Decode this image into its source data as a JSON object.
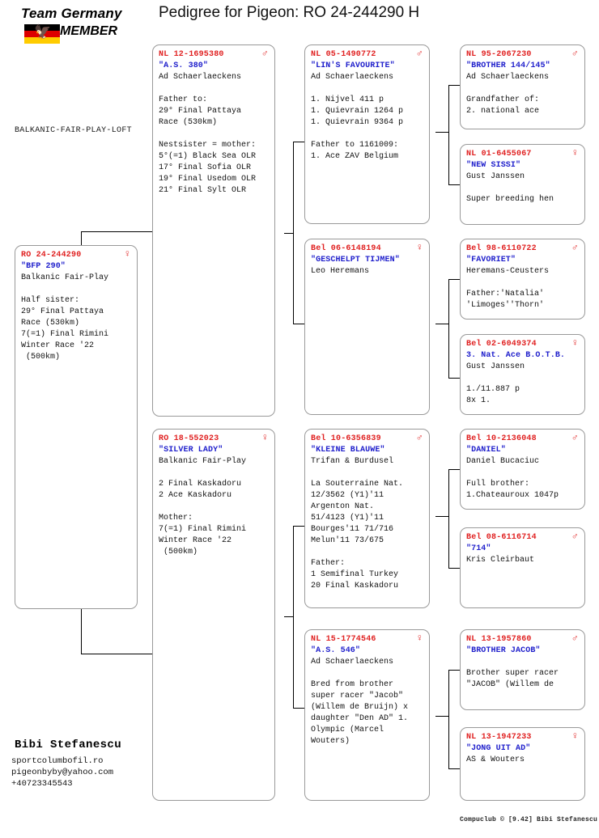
{
  "header": {
    "title": "Pedigree for Pigeon: RO  24-244290 H",
    "logo": {
      "line1": "Team Germany",
      "line2": "MEMBER",
      "icon": "german-flag-eagle"
    },
    "loft_label": "BALKANIC-FAIR-PLAY-LOFT"
  },
  "colors": {
    "ring": "#e02020",
    "nickname": "#2020cc",
    "text": "#111111",
    "box_border": "#999999",
    "line": "#000000"
  },
  "signature": {
    "name": "Bibi Stefanescu",
    "website": "sportcolumbofil.ro",
    "email": "pigeonbyby@yahoo.com",
    "phone": "+40723345543"
  },
  "footer": {
    "text": "Compuclub © [9.42]  Bibi Stefanescu"
  },
  "pedigree": {
    "subject": {
      "ring": "RO   24-244290",
      "sex": "♀",
      "nickname": "\"BFP 290\"",
      "owner": "Balkanic Fair-Play",
      "notes": "Half sister:\n29° Final Pattaya\nRace (530km)\n7(=1) Final Rimini\nWinter Race '22\n (500km)"
    },
    "gen1": [
      {
        "ring": "NL  12-1695380",
        "sex": "♂",
        "nickname": "\"A.S. 380\"",
        "owner": "Ad Schaerlaeckens",
        "notes": "Father to:\n29° Final Pattaya\nRace (530km)\n\nNestsister = mother:\n5°(=1) Black Sea OLR\n17° Final Sofia OLR\n19° Final Usedom OLR\n21° Final Sylt OLR"
      },
      {
        "ring": "RO  18-552023",
        "sex": "♀",
        "nickname": "\"SILVER LADY\"",
        "owner": "Balkanic Fair-Play",
        "notes": "2 Final Kaskadoru\n2 Ace Kaskadoru\n\nMother:\n7(=1) Final Rimini\nWinter Race '22\n (500km)"
      }
    ],
    "gen2": [
      {
        "ring": "NL  05-1490772",
        "sex": "♂",
        "nickname": "\"LIN'S FAVOURITE\"",
        "owner": "Ad Schaerlaeckens",
        "notes": "1. Nijvel 411 p\n1. Quievrain 1264 p\n1. Quievrain 9364 p\n\nFather to 1161009:\n1. Ace ZAV Belgium"
      },
      {
        "ring": "Bel 06-6148194",
        "sex": "♀",
        "nickname": "\"GESCHELPT TIJMEN\"",
        "owner": "Leo Heremans",
        "notes": ""
      },
      {
        "ring": "Bel 10-6356839",
        "sex": "♂",
        "nickname": "\"KLEINE BLAUWE\"",
        "owner": "Trifan & Burdusel",
        "notes": "La Souterraine Nat.\n12/3562 (Y1)'11\nArgenton Nat.\n51/4123 (Y1)'11\nBourges'11 71/716\nMelun'11 73/675\n\nFather:\n1 Semifinal Turkey\n20 Final Kaskadoru"
      },
      {
        "ring": "NL  15-1774546",
        "sex": "♀",
        "nickname": "\"A.S. 546\"",
        "owner": "Ad Schaerlaeckens",
        "notes": "Bred from brother\nsuper racer \"Jacob\"\n(Willem de Bruijn) x\ndaughter \"Den AD\" 1.\nOlympic (Marcel\nWouters)"
      }
    ],
    "gen3": [
      {
        "ring": "NL  95-2067230",
        "sex": "♂",
        "nickname": "\"BROTHER 144/145\"",
        "owner": "Ad Schaerlaeckens",
        "notes": "Grandfather of:\n2. national ace"
      },
      {
        "ring": "NL  01-6455067",
        "sex": "♀",
        "nickname": "\"NEW SISSI\"",
        "owner": "Gust Janssen",
        "notes": "Super breeding hen"
      },
      {
        "ring": "Bel 98-6110722",
        "sex": "♂",
        "nickname": "\"FAVORIET\"",
        "owner": "Heremans-Ceusters",
        "notes": "Father:'Natalia'\n'Limoges''Thorn'"
      },
      {
        "ring": "Bel 02-6049374",
        "sex": "♀",
        "nickname": "3. Nat. Ace B.O.T.B.",
        "owner": "Gust Janssen",
        "notes": "1./11.887 p\n8x 1."
      },
      {
        "ring": "Bel 10-2136048",
        "sex": "♂",
        "nickname": "\"DANIEL\"",
        "owner": "Daniel Bucaciuc",
        "notes": "Full brother:\n1.Chateauroux 1047p"
      },
      {
        "ring": "Bel 08-6116714",
        "sex": "♂",
        "nickname": "\"714\"",
        "owner": "Kris Cleirbaut",
        "notes": ""
      },
      {
        "ring": "NL  13-1957860",
        "sex": "♂",
        "nickname": "\"BROTHER JACOB\"",
        "owner": "",
        "notes": "Brother super racer\n\"JACOB\" (Willem de"
      },
      {
        "ring": "NL  13-1947233",
        "sex": "♀",
        "nickname": "\"JONG UIT AD\"",
        "owner": "AS & Wouters",
        "notes": ""
      }
    ]
  }
}
